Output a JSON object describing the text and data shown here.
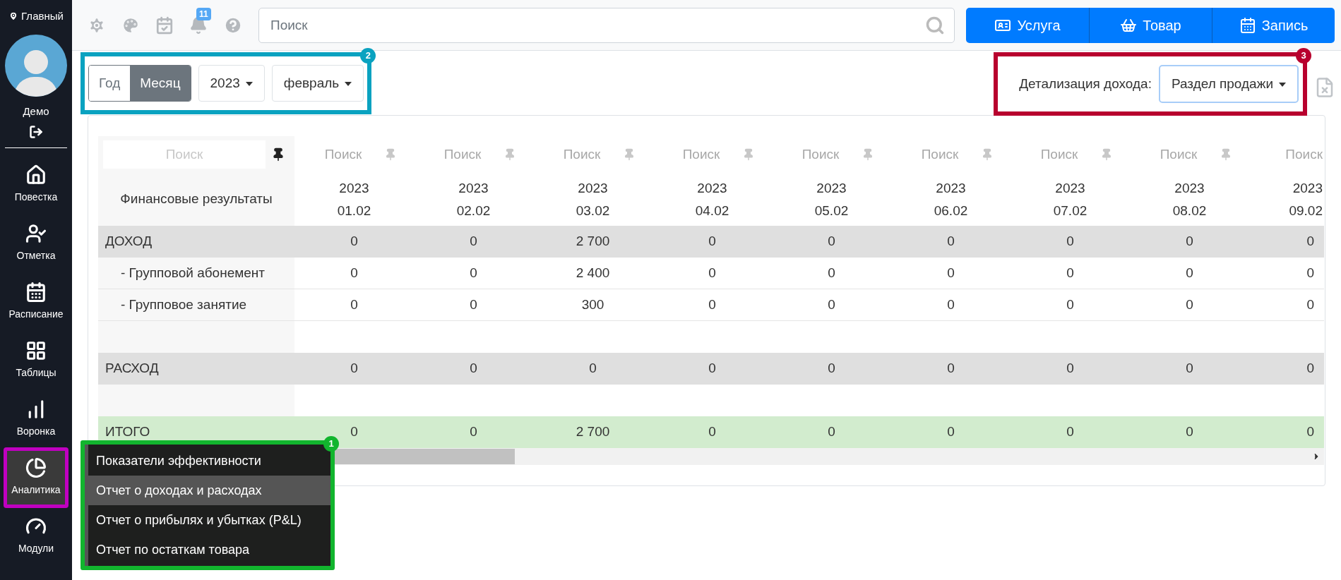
{
  "sidebar": {
    "location": "Главный",
    "user": "Демо",
    "items": [
      {
        "label": "Повестка",
        "selected": false
      },
      {
        "label": "Отметка",
        "selected": false
      },
      {
        "label": "Расписание",
        "selected": false
      },
      {
        "label": "Таблицы",
        "selected": false
      },
      {
        "label": "Воронка",
        "selected": false
      },
      {
        "label": "Аналитика",
        "selected": true,
        "annotation": {
          "color": "#c000c0"
        }
      },
      {
        "label": "Модули",
        "selected": false
      }
    ]
  },
  "toolbar": {
    "notifications": "11",
    "search": {
      "placeholder": "Поиск"
    },
    "actions": [
      {
        "label": "Услуга"
      },
      {
        "label": "Товар"
      },
      {
        "label": "Запись"
      }
    ]
  },
  "period": {
    "annotation": {
      "label": "2",
      "color": "#0aa2c0"
    },
    "modes": [
      {
        "label": "Год",
        "selected": false
      },
      {
        "label": "Месяц",
        "selected": true
      }
    ],
    "year": "2023",
    "month": "февраль"
  },
  "detail": {
    "annotation": {
      "label": "3",
      "color": "#b8002e"
    },
    "label": "Детализация дохода:",
    "value": "Раздел продажи"
  },
  "table": {
    "first_column": {
      "filter": {
        "placeholder": "Поиск",
        "pinned": true
      },
      "title": "Финансовые результаты"
    },
    "columns": [
      {
        "filter": {
          "placeholder": "Поиск",
          "pinned": false
        },
        "year": "2023",
        "date": "01.02"
      },
      {
        "filter": {
          "placeholder": "Поиск",
          "pinned": false
        },
        "year": "2023",
        "date": "02.02"
      },
      {
        "filter": {
          "placeholder": "Поиск",
          "pinned": false
        },
        "year": "2023",
        "date": "03.02"
      },
      {
        "filter": {
          "placeholder": "Поиск",
          "pinned": false
        },
        "year": "2023",
        "date": "04.02"
      },
      {
        "filter": {
          "placeholder": "Поиск",
          "pinned": false
        },
        "year": "2023",
        "date": "05.02"
      },
      {
        "filter": {
          "placeholder": "Поиск",
          "pinned": false
        },
        "year": "2023",
        "date": "06.02"
      },
      {
        "filter": {
          "placeholder": "Поиск",
          "pinned": false
        },
        "year": "2023",
        "date": "07.02"
      },
      {
        "filter": {
          "placeholder": "Поиск",
          "pinned": false
        },
        "year": "2023",
        "date": "08.02"
      },
      {
        "filter": {
          "placeholder": "Поиск"
        },
        "year": "2023",
        "date": "09.02"
      }
    ],
    "rows": [
      {
        "kind": "section",
        "label": "ДОХОД",
        "values": [
          "0",
          "0",
          "2 700",
          "0",
          "0",
          "0",
          "0",
          "0",
          "0"
        ]
      },
      {
        "kind": "item",
        "label": "- Групповой абонемент",
        "values": [
          "0",
          "0",
          "2 400",
          "0",
          "0",
          "0",
          "0",
          "0",
          "0"
        ]
      },
      {
        "kind": "item",
        "label": "- Групповое занятие",
        "values": [
          "0",
          "0",
          "300",
          "0",
          "0",
          "0",
          "0",
          "0",
          "0"
        ]
      },
      {
        "kind": "spacer"
      },
      {
        "kind": "section",
        "label": "РАСХОД",
        "values": [
          "0",
          "0",
          "0",
          "0",
          "0",
          "0",
          "0",
          "0",
          "0"
        ]
      },
      {
        "kind": "spacer"
      },
      {
        "kind": "total",
        "label": "ИТОГО",
        "values": [
          "0",
          "0",
          "2 700",
          "0",
          "0",
          "0",
          "0",
          "0",
          "0"
        ]
      }
    ]
  },
  "analytics_menu": {
    "annotation": {
      "label": "1",
      "color": "#12b52e"
    },
    "items": [
      {
        "label": "Показатели эффективности",
        "selected": false
      },
      {
        "label": "Отчет о доходах и расходах",
        "selected": true
      },
      {
        "label": "Отчет о прибылях и убытках (P&L)",
        "selected": false
      },
      {
        "label": "Отчет по остаткам товара",
        "selected": false
      }
    ]
  }
}
